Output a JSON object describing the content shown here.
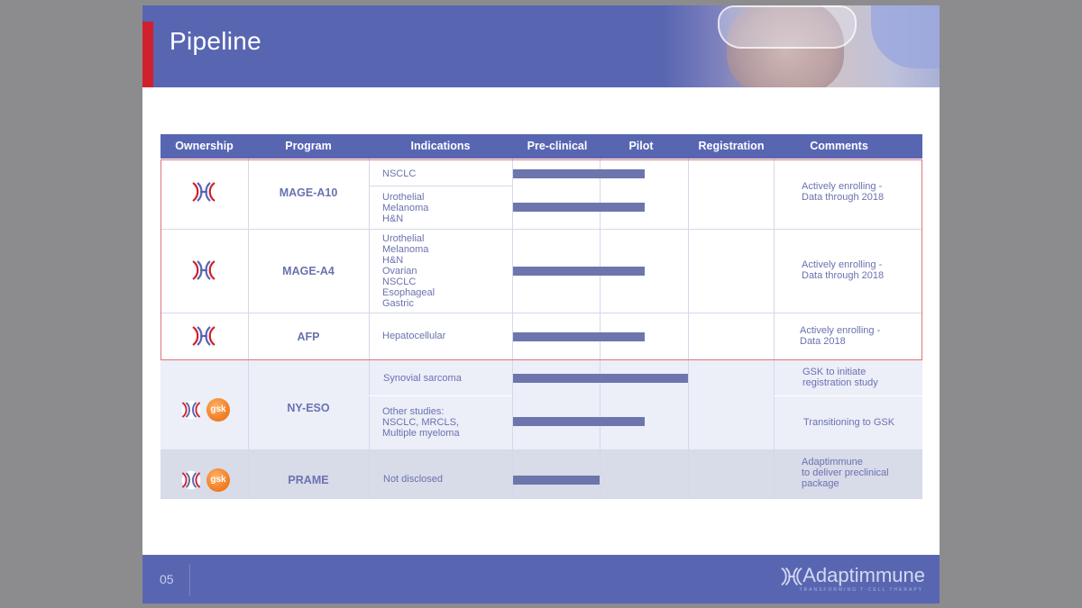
{
  "title": "Pipeline",
  "columns": [
    "Ownership",
    "Program",
    "Indications",
    "Pre-clinical",
    "Pilot",
    "Registration",
    "Comments"
  ],
  "rows": [
    {
      "program": "MAGE-A10",
      "indications": [
        "NSCLC",
        "Urothelial\nMelanoma\nH&N"
      ],
      "progress": [
        0.75,
        0.75
      ],
      "comment": "Actively enrolling -\nData through 2018"
    },
    {
      "program": "MAGE-A4",
      "indications": [
        "Urothelial\nMelanoma\nH&N\nOvarian\nNSCLC\nEsophageal\nGastric"
      ],
      "progress": [
        0.75
      ],
      "comment": "Actively enrolling -\nData through 2018"
    },
    {
      "program": "AFP",
      "indications": [
        "Hepatocellular"
      ],
      "progress": [
        0.75
      ],
      "comment": "Actively enrolling -\nData 2018"
    },
    {
      "program": "NY-ESO",
      "indications": [
        "Synovial sarcoma",
        "Other studies:\nNSCLC, MRCLS,\nMultiple myeloma"
      ],
      "progress": [
        1.0,
        0.75
      ],
      "comments": [
        "GSK to initiate\nregistration study",
        "Transitioning to GSK"
      ]
    },
    {
      "program": "PRAME",
      "indications": [
        "Not disclosed"
      ],
      "progress": [
        0.5
      ],
      "comment": "Adaptimmune\nto deliver preclinical\npackage"
    }
  ],
  "partner_logo_text": "gsk",
  "footer": {
    "page_number": "05",
    "brand": "Adaptimmune",
    "tagline": "TRANSFORMING T-CELL THERAPY"
  },
  "colors": {
    "accent": "#5866b2",
    "red": "#d0202e",
    "bar": "#6d75ad",
    "gsk": "#f07a1f"
  }
}
